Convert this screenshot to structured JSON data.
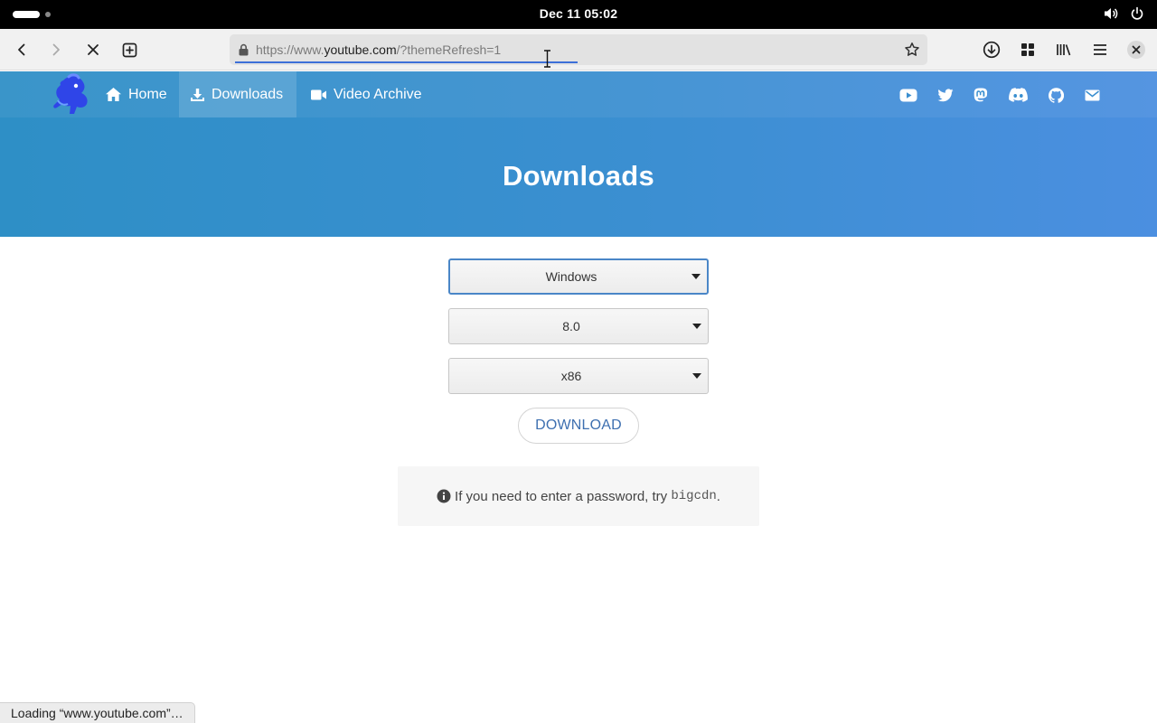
{
  "system": {
    "clock": "Dec 11  05:02"
  },
  "browser": {
    "url_prefix": "https://www.",
    "url_host": "youtube.com",
    "url_suffix": "/?themeRefresh=1",
    "status_text": "Loading “www.youtube.com”…"
  },
  "site": {
    "nav": {
      "home_label": "Home",
      "downloads_label": "Downloads",
      "archive_label": "Video Archive"
    },
    "social_icons": [
      "youtube-icon",
      "twitter-icon",
      "mastodon-icon",
      "discord-icon",
      "github-icon",
      "email-icon"
    ],
    "colors": {
      "header_start": "#2e8fc6",
      "header_end": "#4b8fe0",
      "accent": "#3d6fb0"
    }
  },
  "page": {
    "title": "Downloads",
    "platform_select": {
      "value": "Windows"
    },
    "version_select": {
      "value": "8.0"
    },
    "arch_select": {
      "value": "x86"
    },
    "download_label": "DOWNLOAD",
    "notice": {
      "text": "If you need to enter a password, try",
      "code": "bigcdn",
      "end": "."
    }
  }
}
